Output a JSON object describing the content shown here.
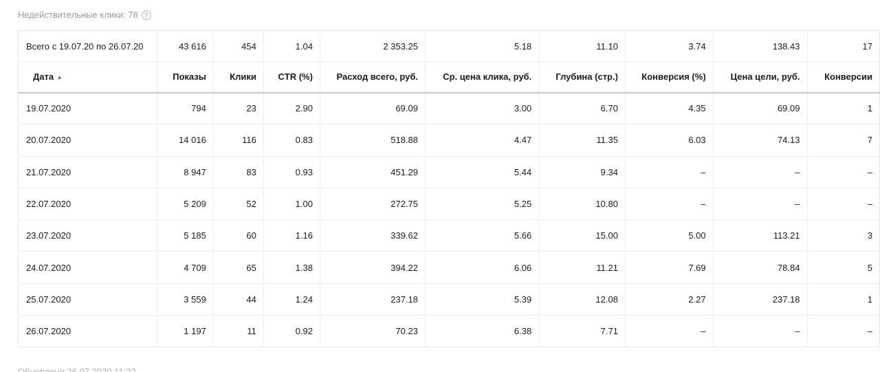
{
  "invalid_clicks": {
    "text": "Недействительные клики: 78",
    "help_icon": "question-circle-icon"
  },
  "table": {
    "total_row": [
      "Всего с 19.07.20 по 26.07.20",
      "43 616",
      "454",
      "1.04",
      "2 353.25",
      "5.18",
      "11.10",
      "3.74",
      "138.43",
      "17"
    ],
    "headers": [
      "Дата",
      "Показы",
      "Клики",
      "CTR (%)",
      "Расход всего, руб.",
      "Ср. цена клика, руб.",
      "Глубина (стр.)",
      "Конверсия (%)",
      "Цена цели, руб.",
      "Конверсии"
    ],
    "sort_indicator": "▲",
    "rows": [
      [
        "19.07.2020",
        "794",
        "23",
        "2.90",
        "69.09",
        "3.00",
        "6.70",
        "4.35",
        "69.09",
        "1"
      ],
      [
        "20.07.2020",
        "14 016",
        "116",
        "0.83",
        "518.88",
        "4.47",
        "11.35",
        "6.03",
        "74.13",
        "7"
      ],
      [
        "21.07.2020",
        "8 947",
        "83",
        "0.93",
        "451.29",
        "5.44",
        "9.34",
        "–",
        "–",
        "–"
      ],
      [
        "22.07.2020",
        "5 209",
        "52",
        "1.00",
        "272.75",
        "5.25",
        "10.80",
        "–",
        "–",
        "–"
      ],
      [
        "23.07.2020",
        "5 185",
        "60",
        "1.16",
        "339.62",
        "5.66",
        "15.00",
        "5.00",
        "113.21",
        "3"
      ],
      [
        "24.07.2020",
        "4 709",
        "65",
        "1.38",
        "394.22",
        "6.06",
        "11.21",
        "7.69",
        "78.84",
        "5"
      ],
      [
        "25.07.2020",
        "3 559",
        "44",
        "1.24",
        "237.18",
        "5.39",
        "12.08",
        "2.27",
        "237.18",
        "1"
      ],
      [
        "26.07.2020",
        "1 197",
        "11",
        "0.92",
        "70.23",
        "6.38",
        "7.71",
        "–",
        "–",
        "–"
      ]
    ]
  },
  "footer": {
    "text": "Обновлено 26.07.2020 11:22"
  }
}
